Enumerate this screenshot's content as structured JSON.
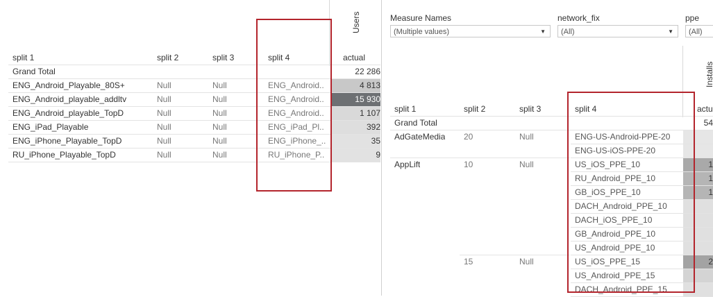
{
  "left": {
    "measure_label": "Users",
    "headers": {
      "split1": "split 1",
      "split2": "split 2",
      "split3": "split 3",
      "split4": "split 4",
      "actual": "actual"
    },
    "grand_total": {
      "label": "Grand Total",
      "value": "22 286"
    },
    "rows": [
      {
        "split1": "ENG_Android_Playable_80S+",
        "split2": "Null",
        "split3": "Null",
        "split4": "ENG_Android..",
        "value": "4 813",
        "shade": "#c8c8c8"
      },
      {
        "split1": "ENG_Android_playable_addltv",
        "split2": "Null",
        "split3": "Null",
        "split4": "ENG_Android..",
        "value": "15 930",
        "shade": "#6d7073"
      },
      {
        "split1": "ENG_Android_playable_TopD",
        "split2": "Null",
        "split3": "Null",
        "split4": "ENG_Android..",
        "value": "1 107",
        "shade": "#d9d9d9"
      },
      {
        "split1": "ENG_iPad_Playable",
        "split2": "Null",
        "split3": "Null",
        "split4": "ENG_iPad_Pl..",
        "value": "392",
        "shade": "#dedede"
      },
      {
        "split1": "ENG_iPhone_Playable_TopD",
        "split2": "Null",
        "split3": "Null",
        "split4": "ENG_iPhone_..",
        "value": "35",
        "shade": "#e2e2e2"
      },
      {
        "split1": "RU_iPhone_Playable_TopD",
        "split2": "Null",
        "split3": "Null",
        "split4": "RU_iPhone_P..",
        "value": "9",
        "shade": "#e2e2e2"
      }
    ]
  },
  "right": {
    "filters": [
      {
        "label": "Measure Names",
        "value": "(Multiple values)"
      },
      {
        "label": "network_fix",
        "value": "(All)"
      },
      {
        "label": "ppe",
        "value": "(All)"
      }
    ],
    "measure_label": "Installs",
    "headers": {
      "split1": "split 1",
      "split2": "split 2",
      "split3": "split 3",
      "split4": "split 4",
      "actual": "actu"
    },
    "grand_total": {
      "label": "Grand Total",
      "value": "54"
    },
    "groups": [
      {
        "split1": "AdGateMedia",
        "split2": "20",
        "split3": "Null"
      },
      {
        "split1": "AppLift",
        "split2": "10",
        "split3": "Null"
      },
      {
        "split1": "",
        "split2": "15",
        "split3": "Null"
      }
    ],
    "split4_values": [
      "ENG-US-Android-PPE-20",
      "ENG-US-iOS-PPE-20",
      "US_iOS_PPE_10",
      "RU_Android_PPE_10",
      "GB_iOS_PPE_10",
      "DACH_Android_PPE_10",
      "DACH_iOS_PPE_10",
      "GB_Android_PPE_10",
      "US_Android_PPE_10",
      "US_iOS_PPE_15",
      "US_Android_PPE_15",
      "DACH_Android_PPE_15"
    ],
    "values": [
      "",
      "",
      "1",
      "1",
      "1",
      "",
      "",
      "",
      "",
      "2",
      "",
      ""
    ],
    "shades": [
      "#e6e6e6",
      "#e6e6e6",
      "#a9a9a9",
      "#b5b5b5",
      "#b5b5b5",
      "#e0e0e0",
      "#e0e0e0",
      "#e0e0e0",
      "#e0e0e0",
      "#a3a3a3",
      "#d4d4d4",
      "#e0e0e0"
    ]
  },
  "highlight_color": "#b3242c"
}
